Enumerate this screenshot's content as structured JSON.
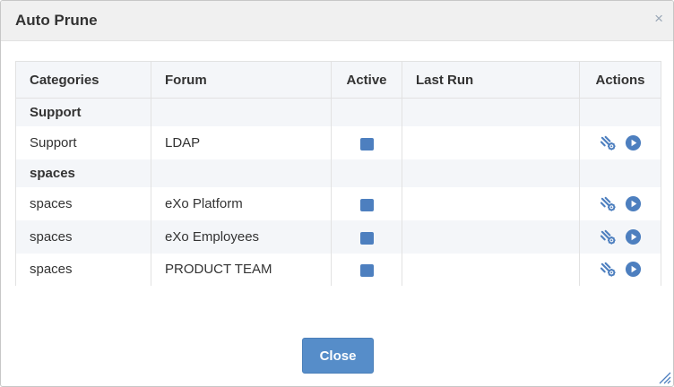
{
  "dialog": {
    "title": "Auto Prune",
    "close_glyph": "×"
  },
  "table": {
    "headers": {
      "categories": "Categories",
      "forum": "Forum",
      "active": "Active",
      "last_run": "Last Run",
      "actions": "Actions"
    },
    "groups": [
      {
        "name": "Support",
        "rows": [
          {
            "category": "Support",
            "forum": "LDAP",
            "active": true,
            "last_run": ""
          }
        ]
      },
      {
        "name": "spaces",
        "rows": [
          {
            "category": "spaces",
            "forum": "eXo Platform",
            "active": true,
            "last_run": ""
          },
          {
            "category": "spaces",
            "forum": "eXo Employees",
            "active": true,
            "last_run": ""
          },
          {
            "category": "spaces",
            "forum": "PRODUCT TEAM",
            "active": true,
            "last_run": ""
          }
        ]
      }
    ],
    "action_icons": [
      "prune-settings-icon",
      "run-icon"
    ]
  },
  "footer": {
    "close_label": "Close"
  },
  "colors": {
    "accent": "#568dc9",
    "icon": "#4d7fbf",
    "header_bg": "#f0f0f0",
    "row_alt_bg": "#f4f6f9"
  }
}
